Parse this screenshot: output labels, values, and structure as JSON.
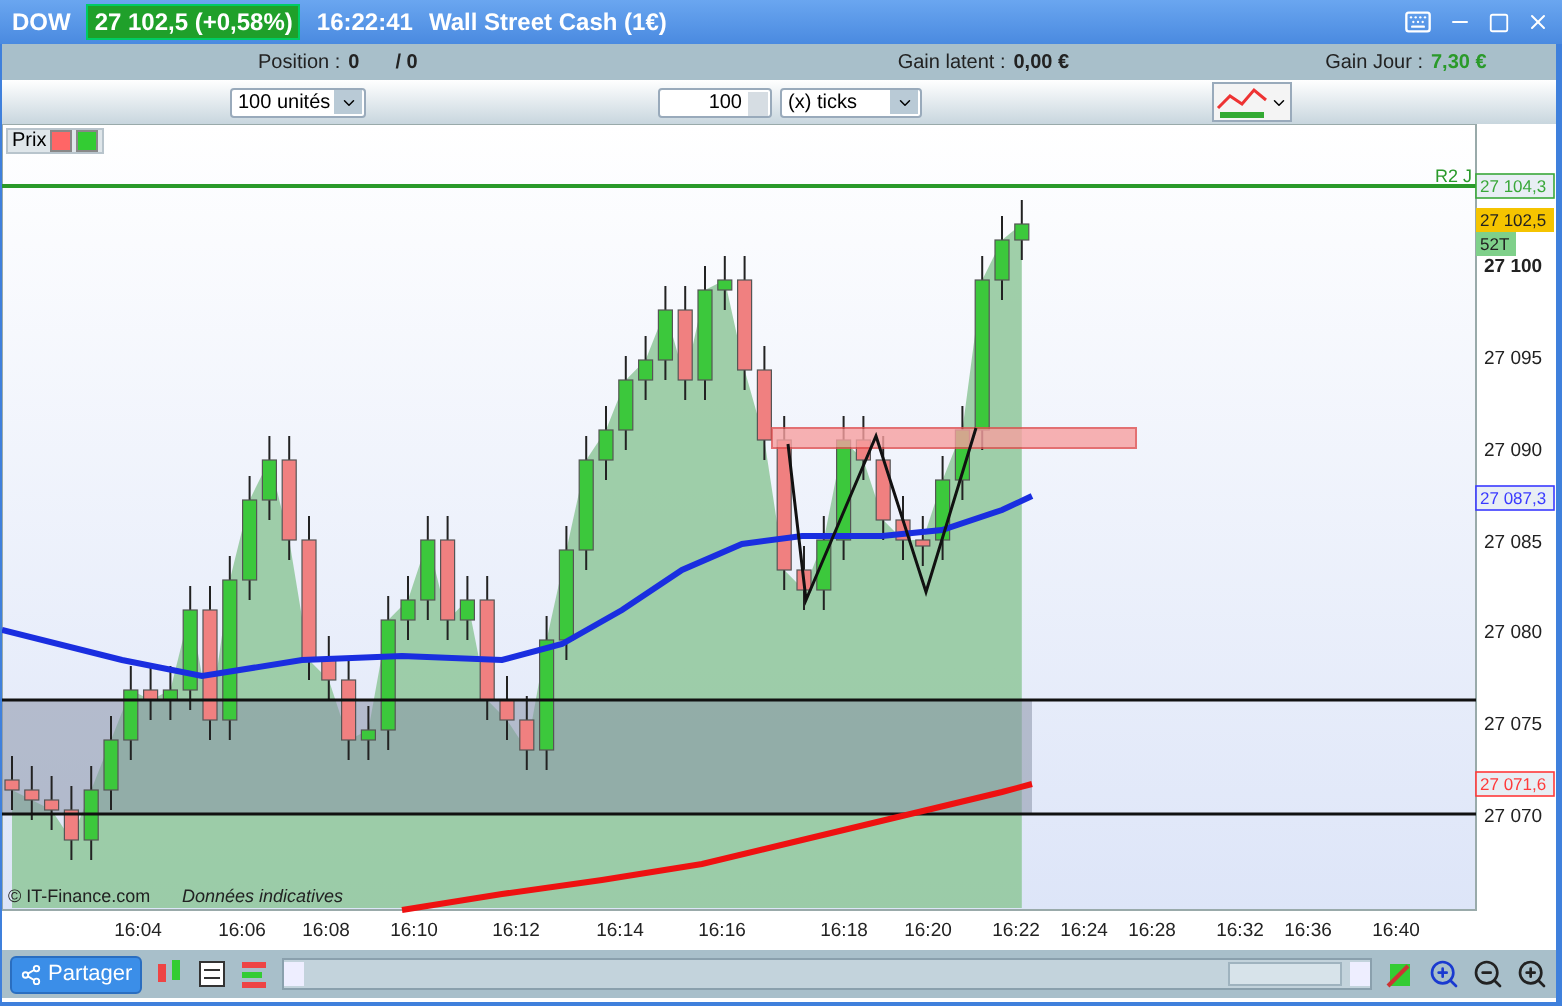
{
  "window": {
    "symbol": "DOW",
    "quote": "27 102,5 (+0,58%)",
    "time": "16:22:41",
    "title": "Wall Street Cash (1€)"
  },
  "position_bar": {
    "position_label": "Position :",
    "position_value": "0",
    "orders_value": "/ 0",
    "latent_label": "Gain latent :",
    "latent_value": "0,00 €",
    "day_label": "Gain Jour :",
    "day_value": "7,30 €"
  },
  "toolbar": {
    "quantity": "100 unités",
    "step": "100",
    "unit": "(x) ticks"
  },
  "chart": {
    "panel_label": "Prix",
    "level_label": "R2 J",
    "price_tags": [
      {
        "text": "27 104,3",
        "kind": "outline",
        "color": "#3aa83a"
      },
      {
        "text": "27 102,5",
        "kind": "filled",
        "color": "#f5c400"
      },
      {
        "text": "52T",
        "kind": "filled",
        "color": "#7fd08a"
      },
      {
        "text": "27 087,3",
        "kind": "outline",
        "color": "#3a3aff"
      },
      {
        "text": "27 071,6",
        "kind": "outline",
        "color": "#ff3a3a"
      }
    ],
    "price_ticks": [
      "27 100",
      "27 095",
      "27 090",
      "27 085",
      "27 080",
      "27 075",
      "27 070"
    ],
    "time_ticks": [
      "16:04",
      "16:06",
      "16:08",
      "16:10",
      "16:12",
      "16:14",
      "16:16",
      "16:18",
      "16:20",
      "16:22",
      "16:24",
      "16:28",
      "16:32",
      "16:36",
      "16:40"
    ],
    "copyright": "© IT-Finance.com",
    "disclaimer": "Données indicatives"
  },
  "bottom_bar": {
    "share": "Partager"
  }
}
